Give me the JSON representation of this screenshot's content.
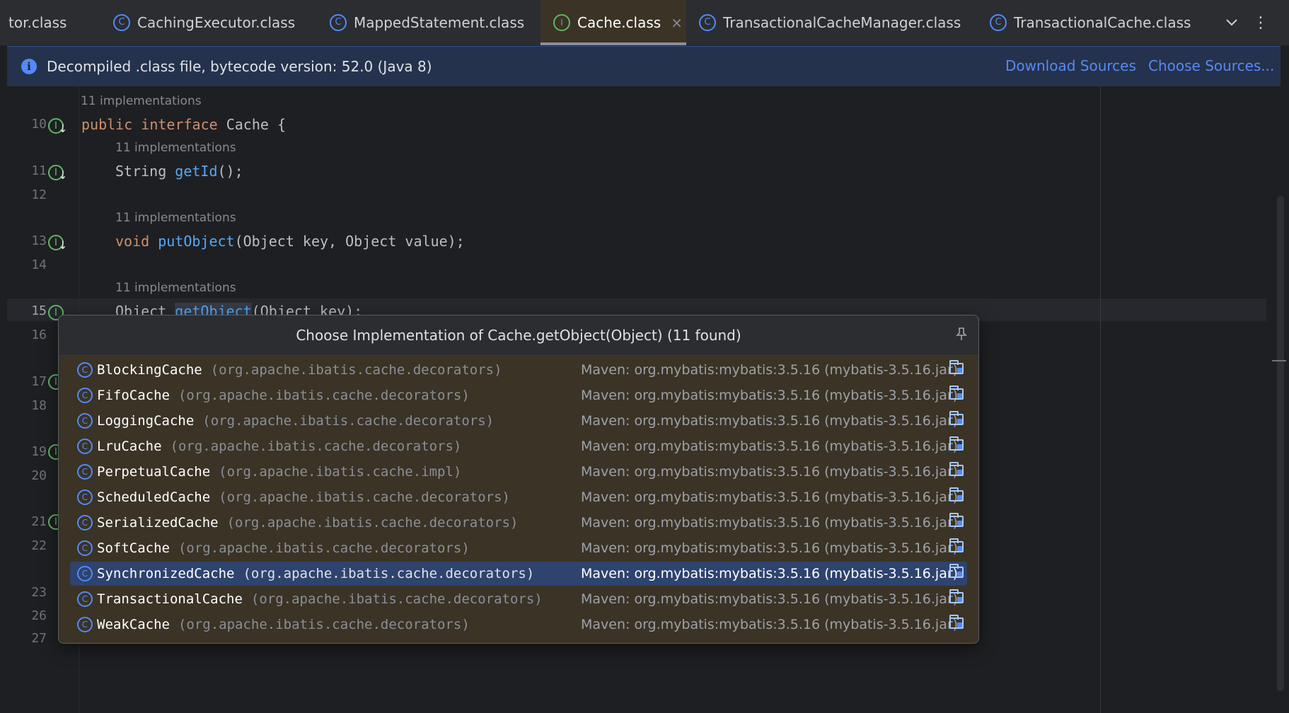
{
  "tabs": [
    {
      "label": "tor.class",
      "icon": "class-icon",
      "active": false
    },
    {
      "label": "CachingExecutor.class",
      "icon": "class-icon",
      "active": false
    },
    {
      "label": "MappedStatement.class",
      "icon": "class-icon",
      "active": false
    },
    {
      "label": "Cache.class",
      "icon": "interface-icon",
      "active": true
    },
    {
      "label": "TransactionalCacheManager.class",
      "icon": "class-icon",
      "active": false
    },
    {
      "label": "TransactionalCache.class",
      "icon": "class-icon",
      "active": false
    }
  ],
  "banner": {
    "text": "Decompiled .class file, bytecode version: 52.0 (Java 8)",
    "download_link": "Download Sources",
    "choose_link": "Choose Sources..."
  },
  "editor": {
    "hint": "11 implementations",
    "line_numbers": [
      "10",
      "11",
      "12",
      "13",
      "14",
      "15",
      "16",
      "17",
      "18",
      "19",
      "20",
      "21",
      "22",
      "23",
      "26",
      "27"
    ],
    "code": {
      "l10": [
        "public",
        "interface",
        "Cache {"
      ],
      "l11": [
        "String ",
        "getId",
        "();"
      ],
      "l13": [
        "void",
        "putObject",
        "(Object key, Object value);"
      ],
      "l15": [
        "Object ",
        "getObject",
        "(Object key);"
      ]
    }
  },
  "popup": {
    "title": "Choose Implementation of Cache.getObject(Object) (11 found)",
    "location": "Maven: org.mybatis:mybatis:3.5.16 (mybatis-3.5.16.jar)",
    "items": [
      {
        "name": "BlockingCache",
        "pkg": "(org.apache.ibatis.cache.decorators)"
      },
      {
        "name": "FifoCache",
        "pkg": "(org.apache.ibatis.cache.decorators)"
      },
      {
        "name": "LoggingCache",
        "pkg": "(org.apache.ibatis.cache.decorators)"
      },
      {
        "name": "LruCache",
        "pkg": "(org.apache.ibatis.cache.decorators)"
      },
      {
        "name": "PerpetualCache",
        "pkg": "(org.apache.ibatis.cache.impl)"
      },
      {
        "name": "ScheduledCache",
        "pkg": "(org.apache.ibatis.cache.decorators)"
      },
      {
        "name": "SerializedCache",
        "pkg": "(org.apache.ibatis.cache.decorators)"
      },
      {
        "name": "SoftCache",
        "pkg": "(org.apache.ibatis.cache.decorators)"
      },
      {
        "name": "SynchronizedCache",
        "pkg": "(org.apache.ibatis.cache.decorators)",
        "selected": true
      },
      {
        "name": "TransactionalCache",
        "pkg": "(org.apache.ibatis.cache.decorators)"
      },
      {
        "name": "WeakCache",
        "pkg": "(org.apache.ibatis.cache.decorators)"
      }
    ]
  },
  "colors": {
    "accent": "#548af7",
    "selection": "#2e436e",
    "popup_bg": "#3a3326",
    "keyword": "#cf8e6d",
    "function": "#56a8f5"
  }
}
